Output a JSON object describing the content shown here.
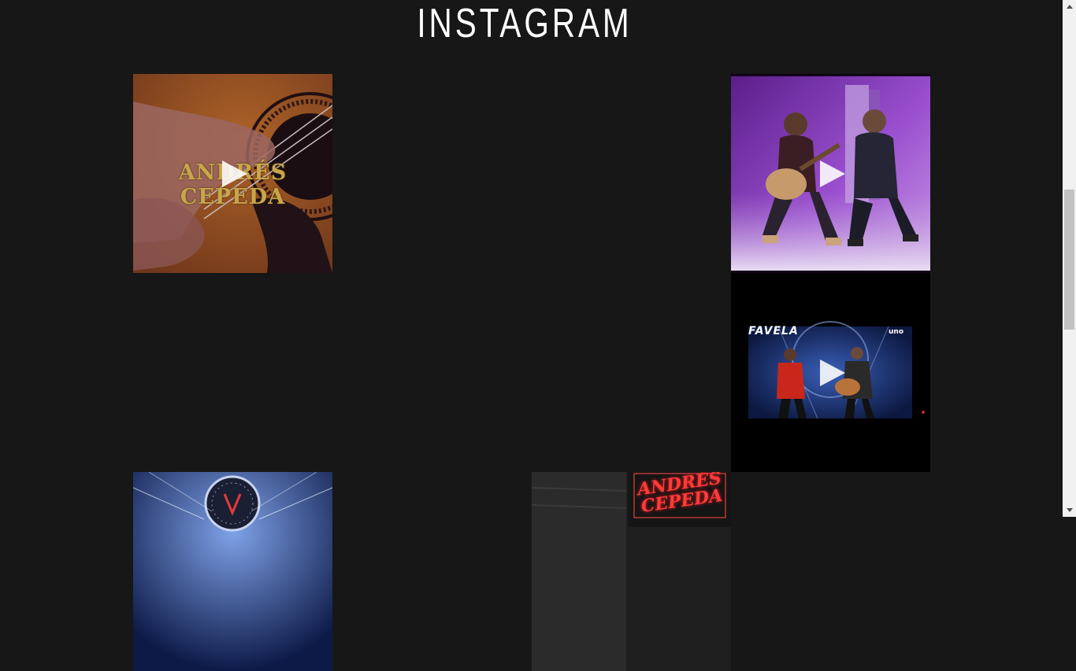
{
  "section": {
    "title": "INSTAGRAM"
  },
  "posts": [
    {
      "kind": "video",
      "overlay_text": "ANDRÉS CEPEDA"
    },
    {
      "kind": "video"
    },
    {
      "kind": "video",
      "overlay_text": "FAVELA",
      "channel_logo": "uno"
    },
    {
      "kind": "image"
    },
    {
      "kind": "image",
      "overlay_text": "ANDRÉS CEPEDA"
    }
  ],
  "icons": {
    "play": "play-icon",
    "scroll_up": "scroll-up-arrow-icon",
    "scroll_down": "scroll-down-arrow-icon"
  },
  "colors": {
    "background": "#171717",
    "title": "#ffffff",
    "gold_text": "#c9a64a",
    "neon_red": "#ff3b3b",
    "purple_stage": "#7b3aa8"
  }
}
